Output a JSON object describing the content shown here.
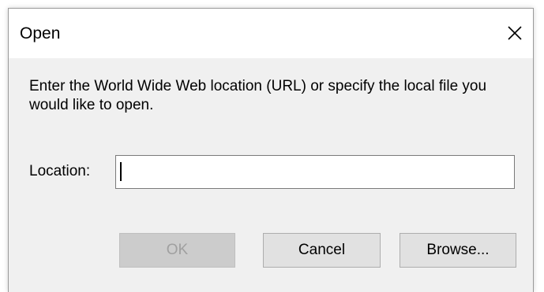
{
  "window": {
    "title": "Open",
    "close_icon": "close-icon"
  },
  "dialog": {
    "message": "Enter the World Wide Web location (URL) or specify the local file you would like to open.",
    "location_label": "Location:",
    "location_value": "",
    "ok_label": "OK",
    "ok_enabled": false,
    "cancel_label": "Cancel",
    "browse_label": "Browse..."
  },
  "colors": {
    "dialog_background": "#f0f0f0",
    "titlebar_background": "#ffffff",
    "button_background": "#e1e1e1",
    "disabled_text": "#a0a0a0"
  }
}
